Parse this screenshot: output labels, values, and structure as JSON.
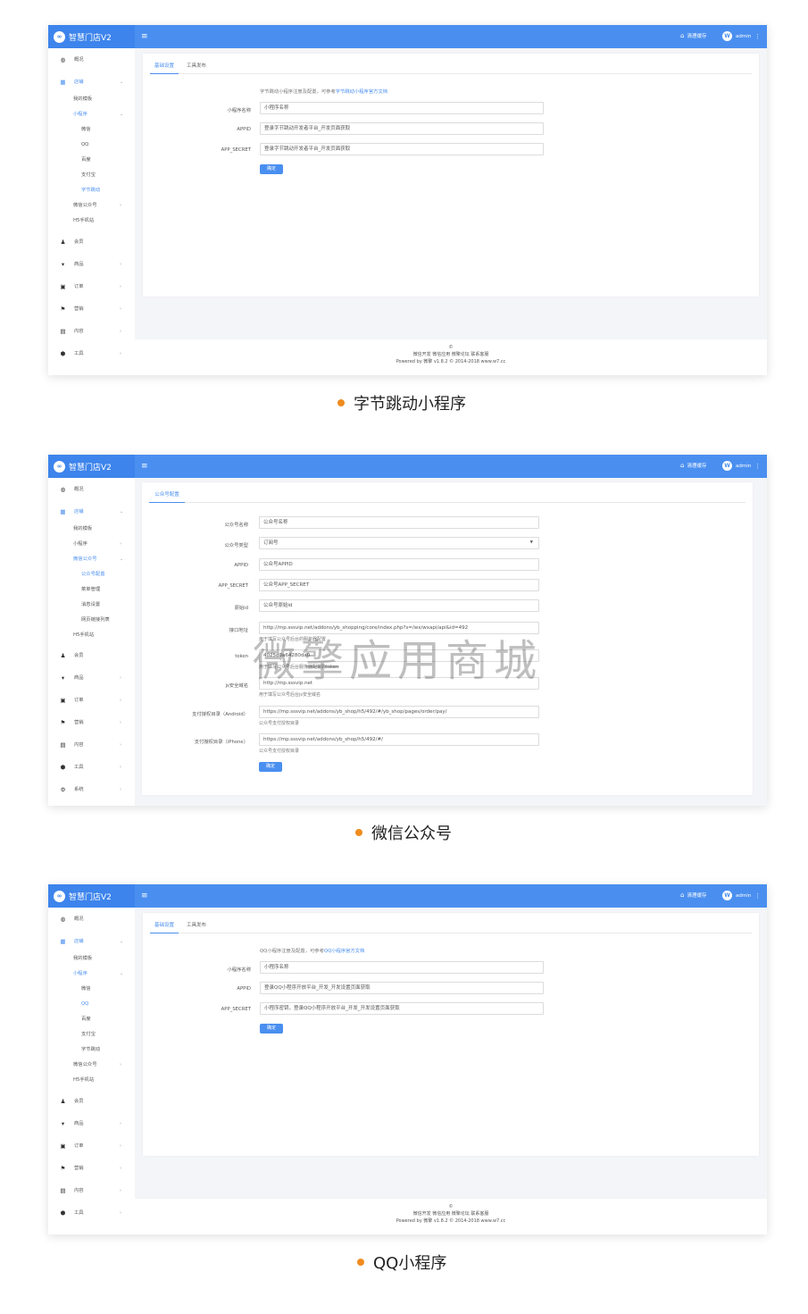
{
  "shots": [
    {
      "brand": {
        "logo": "∞",
        "name": "智慧门店V2"
      },
      "header": {
        "menu_icon": "≡",
        "cache_label": "清理缓存",
        "avatar_letter": "W",
        "user": "admin"
      },
      "sidebar": [
        {
          "label": "概况",
          "icon": "dashboard-icon",
          "glyph": "◍",
          "level": 1
        },
        {
          "label": "店铺",
          "icon": "grid-icon",
          "glyph": "▦",
          "level": 1,
          "active": true,
          "arrow": "⌄"
        },
        {
          "label": "我的模板",
          "level": 2
        },
        {
          "label": "小程序",
          "level": 2,
          "active": true,
          "arrow": "⌄"
        },
        {
          "label": "微信",
          "level": 3
        },
        {
          "label": "QQ",
          "level": 3
        },
        {
          "label": "百度",
          "level": 3
        },
        {
          "label": "支付宝",
          "level": 3
        },
        {
          "label": "字节跳动",
          "level": 3,
          "active": true
        },
        {
          "label": "微信公众号",
          "level": 2,
          "arrow": "›"
        },
        {
          "label": "H5手机站",
          "level": 2
        },
        {
          "label": "会员",
          "icon": "users-icon",
          "glyph": "♟",
          "level": 1
        },
        {
          "label": "商品",
          "icon": "cart-icon",
          "glyph": "▾",
          "level": 1,
          "arrow": "›"
        },
        {
          "label": "订单",
          "icon": "order-icon",
          "glyph": "▣",
          "level": 1,
          "arrow": "›"
        },
        {
          "label": "营销",
          "icon": "flag-icon",
          "glyph": "⚑",
          "level": 1,
          "arrow": "›"
        },
        {
          "label": "内容",
          "icon": "document-icon",
          "glyph": "▤",
          "level": 1,
          "arrow": "›"
        },
        {
          "label": "工具",
          "icon": "cube-icon",
          "glyph": "⬢",
          "level": 1,
          "arrow": "›"
        }
      ],
      "tabs": [
        {
          "label": "基础设置",
          "active": true
        },
        {
          "label": "工具发布"
        }
      ],
      "hint": {
        "text": "字节跳动小程序注册及配置，可参考",
        "link": "字节跳动小程序官方文档"
      },
      "fields": [
        {
          "label": "小程序名称",
          "value": "小程序名称"
        },
        {
          "label": "APPID",
          "value": "登录字节跳动开发者平台_开发页面获取"
        },
        {
          "label": "APP_SECRET",
          "value": "登录字节跳动开发者平台_开发页面获取"
        }
      ],
      "submit": "确定",
      "footer": [
        "©",
        "微信开发 微信应用 微擎论坛 联系客服",
        "Powered by 微擎 v1.8.2 © 2014-2018 www.w7.cc"
      ],
      "caption": "字节跳动小程序"
    },
    {
      "brand": {
        "logo": "∞",
        "name": "智慧门店V2"
      },
      "header": {
        "menu_icon": "≡",
        "cache_label": "清理缓存",
        "avatar_letter": "W",
        "user": "admin"
      },
      "sidebar": [
        {
          "label": "概况",
          "icon": "dashboard-icon",
          "glyph": "◍",
          "level": 1
        },
        {
          "label": "店铺",
          "icon": "grid-icon",
          "glyph": "▦",
          "level": 1,
          "active": true,
          "arrow": "⌄"
        },
        {
          "label": "我的模板",
          "level": 2
        },
        {
          "label": "小程序",
          "level": 2,
          "arrow": "›"
        },
        {
          "label": "微信公众号",
          "level": 2,
          "active": true,
          "arrow": "⌄"
        },
        {
          "label": "公众号配置",
          "level": 3,
          "active": true
        },
        {
          "label": "菜单管理",
          "level": 3
        },
        {
          "label": "消息设置",
          "level": 3
        },
        {
          "label": "网页链接列表",
          "level": 3
        },
        {
          "label": "H5手机站",
          "level": 2
        },
        {
          "label": "会员",
          "icon": "users-icon",
          "glyph": "♟",
          "level": 1
        },
        {
          "label": "商品",
          "icon": "cart-icon",
          "glyph": "▾",
          "level": 1,
          "arrow": "›"
        },
        {
          "label": "订单",
          "icon": "order-icon",
          "glyph": "▣",
          "level": 1,
          "arrow": "›"
        },
        {
          "label": "营销",
          "icon": "flag-icon",
          "glyph": "⚑",
          "level": 1,
          "arrow": "›"
        },
        {
          "label": "内容",
          "icon": "document-icon",
          "glyph": "▤",
          "level": 1,
          "arrow": "›"
        },
        {
          "label": "工具",
          "icon": "cube-icon",
          "glyph": "⬢",
          "level": 1,
          "arrow": "›"
        },
        {
          "label": "系统",
          "icon": "gear-icon",
          "glyph": "⚙",
          "level": 1,
          "arrow": "›"
        }
      ],
      "tabs": [
        {
          "label": "公众号配置",
          "active": true
        }
      ],
      "fields": [
        {
          "label": "公众号名称",
          "value": "公众号名称"
        },
        {
          "label": "公众号类型",
          "value": "订阅号",
          "select": true
        },
        {
          "label": "APPID",
          "value": "公众号APPID"
        },
        {
          "label": "APP_SECRET",
          "value": "公众号APP_SECRET"
        },
        {
          "label": "原始id",
          "value": "公众号原始id"
        },
        {
          "label": "接口地址",
          "value": "http://mp.sssvip.net/addons/yb_shopping/core/index.php?s=/wx/wxapi/api&id=492",
          "help": "用于填写公众号后台的服务器配置"
        },
        {
          "label": "token",
          "value": "4025d0a64280da0",
          "help": "用于填写公众号后台服务器配置的token"
        },
        {
          "label": "js安全域名",
          "value": "http://mp.sssvip.net",
          "help": "用于填写公众号后台js安全域名"
        },
        {
          "label": "支付授权目录（Android）",
          "value": "https://mp.sssvip.net/addons/yb_shop/h5/492/#/yb_shop/pages/order/pay/",
          "help": "公众号支付授权目录"
        },
        {
          "label": "支付授权目录（iPhone）",
          "value": "https://mp.sssvip.net/addons/yb_shop/h5/492/#/",
          "help": "公众号支付授权目录"
        }
      ],
      "submit": "确定",
      "caption": "微信公众号"
    },
    {
      "brand": {
        "logo": "∞",
        "name": "智慧门店V2"
      },
      "header": {
        "menu_icon": "≡",
        "cache_label": "清理缓存",
        "avatar_letter": "W",
        "user": "admin"
      },
      "sidebar": [
        {
          "label": "概况",
          "icon": "dashboard-icon",
          "glyph": "◍",
          "level": 1
        },
        {
          "label": "店铺",
          "icon": "grid-icon",
          "glyph": "▦",
          "level": 1,
          "active": true,
          "arrow": "⌄"
        },
        {
          "label": "我的模板",
          "level": 2
        },
        {
          "label": "小程序",
          "level": 2,
          "active": true,
          "arrow": "⌄"
        },
        {
          "label": "微信",
          "level": 3
        },
        {
          "label": "QQ",
          "level": 3,
          "active": true
        },
        {
          "label": "百度",
          "level": 3
        },
        {
          "label": "支付宝",
          "level": 3
        },
        {
          "label": "字节跳动",
          "level": 3
        },
        {
          "label": "微信公众号",
          "level": 2,
          "arrow": "›"
        },
        {
          "label": "H5手机站",
          "level": 2
        },
        {
          "label": "会员",
          "icon": "users-icon",
          "glyph": "♟",
          "level": 1
        },
        {
          "label": "商品",
          "icon": "cart-icon",
          "glyph": "▾",
          "level": 1,
          "arrow": "›"
        },
        {
          "label": "订单",
          "icon": "order-icon",
          "glyph": "▣",
          "level": 1,
          "arrow": "›"
        },
        {
          "label": "营销",
          "icon": "flag-icon",
          "glyph": "⚑",
          "level": 1,
          "arrow": "›"
        },
        {
          "label": "内容",
          "icon": "document-icon",
          "glyph": "▤",
          "level": 1,
          "arrow": "›"
        },
        {
          "label": "工具",
          "icon": "cube-icon",
          "glyph": "⬢",
          "level": 1,
          "arrow": "›"
        }
      ],
      "tabs": [
        {
          "label": "基础设置",
          "active": true
        },
        {
          "label": "工具发布"
        }
      ],
      "hint": {
        "text": "QQ小程序注册及配置，可参考",
        "link": "QQ小程序官方文档"
      },
      "fields": [
        {
          "label": "小程序名称",
          "value": "小程序名称"
        },
        {
          "label": "APPID",
          "value": "登录QQ小程序开放平台_开发_开发设置页面获取"
        },
        {
          "label": "APP_SECRET",
          "value": "小程序密钥，登录QQ小程序开放平台_开发_开发设置页面获取"
        }
      ],
      "submit": "确定",
      "footer": [
        "©",
        "微信开发 微信应用 微擎论坛 联系客服",
        "Powered by 微擎 v1.8.2 © 2014-2018 www.w7.cc"
      ],
      "caption": "QQ小程序"
    }
  ],
  "watermark": "微擎应用商城",
  "colors": {
    "primary": "#4a8ff0",
    "caption_dot": "#f08c1e"
  }
}
